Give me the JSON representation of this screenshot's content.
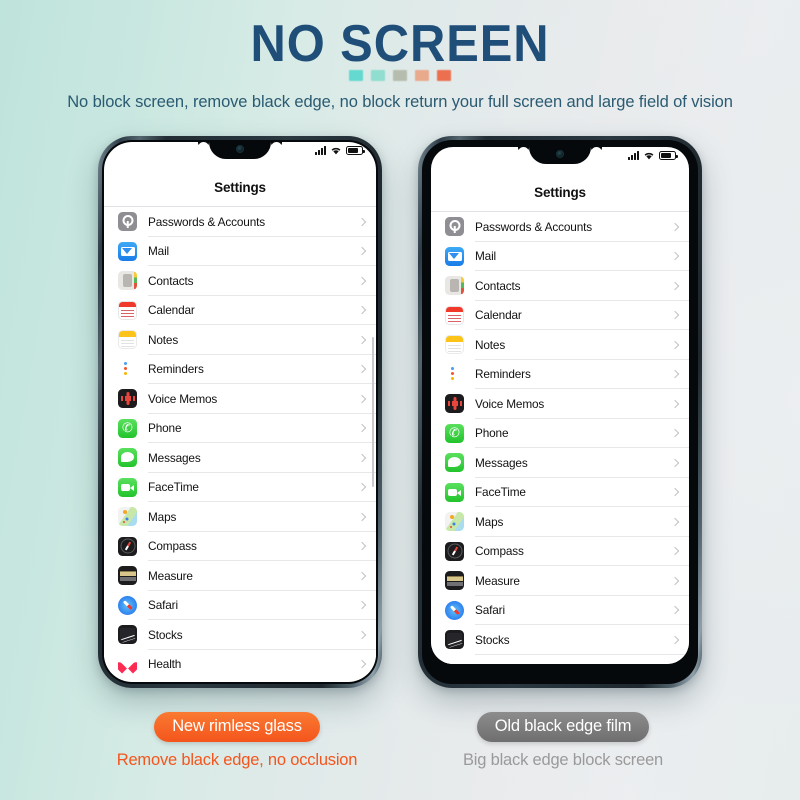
{
  "header": {
    "headline": "NO SCREEN",
    "subheadline": "No block screen, remove black edge, no block return your full screen and large field of vision",
    "headline_color": "#1f4e79",
    "dots": [
      "#63d9cf",
      "#8fded0",
      "#b7bdae",
      "#e8a98c",
      "#ec7050"
    ]
  },
  "phone_screen": {
    "nav_title": "Settings",
    "status": {
      "signal_icon": "signal-bars-icon",
      "wifi_icon": "wifi-icon",
      "battery_icon": "battery-icon"
    },
    "rows": [
      {
        "label": "Passwords & Accounts",
        "icon": "passwords-app-icon"
      },
      {
        "label": "Mail",
        "icon": "mail-app-icon"
      },
      {
        "label": "Contacts",
        "icon": "contacts-app-icon"
      },
      {
        "label": "Calendar",
        "icon": "calendar-app-icon"
      },
      {
        "label": "Notes",
        "icon": "notes-app-icon"
      },
      {
        "label": "Reminders",
        "icon": "reminders-app-icon"
      },
      {
        "label": "Voice Memos",
        "icon": "voice-memos-app-icon"
      },
      {
        "label": "Phone",
        "icon": "phone-app-icon"
      },
      {
        "label": "Messages",
        "icon": "messages-app-icon"
      },
      {
        "label": "FaceTime",
        "icon": "facetime-app-icon"
      },
      {
        "label": "Maps",
        "icon": "maps-app-icon"
      },
      {
        "label": "Compass",
        "icon": "compass-app-icon"
      },
      {
        "label": "Measure",
        "icon": "measure-app-icon"
      },
      {
        "label": "Safari",
        "icon": "safari-app-icon"
      },
      {
        "label": "Stocks",
        "icon": "stocks-app-icon"
      },
      {
        "label": "Health",
        "icon": "health-app-icon"
      }
    ]
  },
  "captions": {
    "left": {
      "badge": "New rimless glass",
      "text": "Remove black edge, no occlusion",
      "badge_color": "#f4551c",
      "text_color": "#f4551c"
    },
    "right": {
      "badge": "Old black edge film",
      "text": "Big black edge block screen",
      "badge_color": "#7a7a7a",
      "text_color": "#9a9a9a"
    }
  }
}
